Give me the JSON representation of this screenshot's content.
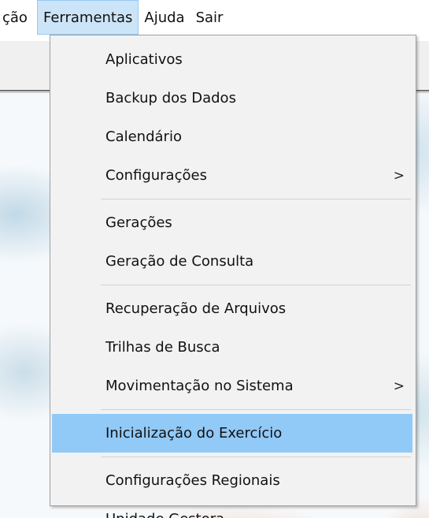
{
  "menubar": {
    "items": [
      {
        "label": "ção",
        "active": false
      },
      {
        "label": "Ferramentas",
        "active": true
      },
      {
        "label": "Ajuda",
        "active": false
      },
      {
        "label": "Sair",
        "active": false
      }
    ]
  },
  "dropdown": {
    "groups": [
      {
        "items": [
          {
            "label": "Aplicativos",
            "submenu": false
          },
          {
            "label": "Backup dos Dados",
            "submenu": false
          },
          {
            "label": "Calendário",
            "submenu": false
          },
          {
            "label": "Configurações",
            "submenu": true
          }
        ]
      },
      {
        "items": [
          {
            "label": "Gerações",
            "submenu": false
          },
          {
            "label": "Geração de Consulta",
            "submenu": false
          }
        ]
      },
      {
        "items": [
          {
            "label": "Recuperação de Arquivos",
            "submenu": false
          },
          {
            "label": "Trilhas de Busca",
            "submenu": false
          },
          {
            "label": "Movimentação no Sistema",
            "submenu": true
          }
        ]
      },
      {
        "items": [
          {
            "label": "Inicialização do Exercício",
            "submenu": false,
            "highlighted": true
          }
        ]
      },
      {
        "items": [
          {
            "label": "Configurações Regionais",
            "submenu": false
          },
          {
            "label": "Unidade Gestora",
            "submenu": false
          }
        ]
      }
    ],
    "submenu_glyph": ">"
  },
  "colors": {
    "menubar_active_bg": "#cce4f7",
    "menu_highlight_bg": "#91c9f7",
    "menu_bg": "#f2f2f2"
  }
}
